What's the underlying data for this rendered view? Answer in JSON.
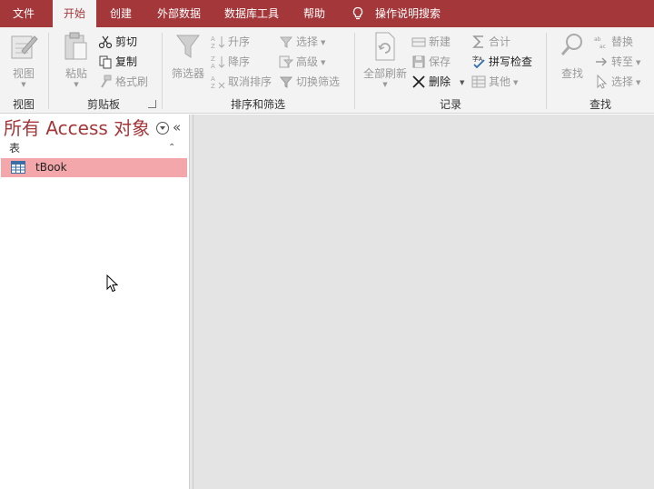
{
  "menu": {
    "tabs": [
      {
        "label": "文件"
      },
      {
        "label": "开始"
      },
      {
        "label": "创建"
      },
      {
        "label": "外部数据"
      },
      {
        "label": "数据库工具"
      },
      {
        "label": "帮助"
      }
    ],
    "tell_me": "操作说明搜索"
  },
  "ribbon": {
    "view": {
      "group_label": "视图",
      "view_btn": "视图"
    },
    "clipboard": {
      "group_label": "剪贴板",
      "paste": "粘贴",
      "cut": "剪切",
      "copy": "复制",
      "format_painter": "格式刷"
    },
    "sort_filter": {
      "group_label": "排序和筛选",
      "filter": "筛选器",
      "ascending": "升序",
      "descending": "降序",
      "remove_sort": "取消排序",
      "selection": "选择",
      "advanced": "高级",
      "toggle_filter": "切换筛选"
    },
    "records": {
      "group_label": "记录",
      "refresh_all": "全部刷新",
      "new": "新建",
      "save": "保存",
      "delete": "删除",
      "totals": "合计",
      "spelling": "拼写检查",
      "more": "其他"
    },
    "find": {
      "group_label": "查找",
      "find": "查找",
      "replace": "替换",
      "goto": "转至",
      "select": "选择"
    }
  },
  "nav_pane": {
    "title": "所有 Access 对象",
    "collapse_glyph": "«",
    "group": {
      "label": "表",
      "collapse_glyph": "⌃"
    },
    "items": [
      {
        "label": "tBook",
        "icon": "table-icon"
      }
    ]
  },
  "colors": {
    "accent": "#a4373a",
    "selected": "#f4a7aa",
    "ribbon_bg": "#f3f3f3",
    "workspace": "#e4e4e4"
  }
}
